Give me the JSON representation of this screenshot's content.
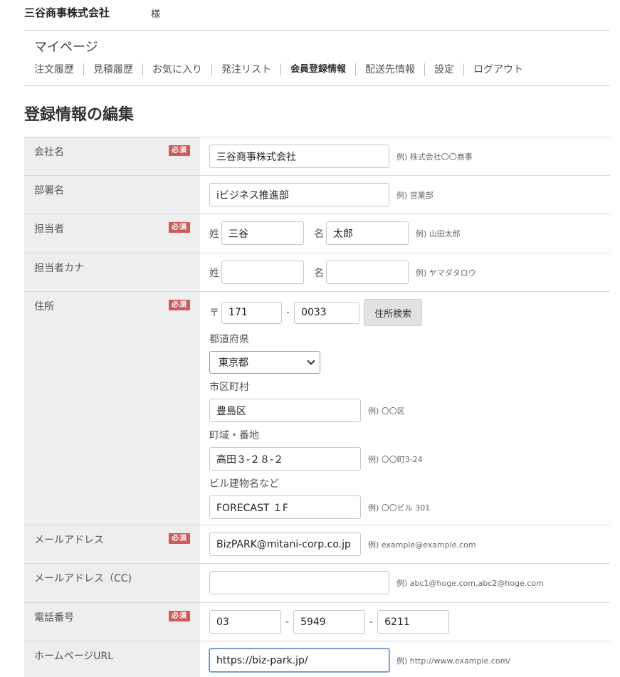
{
  "header": {
    "company": "三谷商事株式会社",
    "honorific": "様"
  },
  "mypage": {
    "title": "マイページ",
    "nav": [
      {
        "label": "注文履歴",
        "active": false
      },
      {
        "label": "見積履歴",
        "active": false
      },
      {
        "label": "お気に入り",
        "active": false
      },
      {
        "label": "発注リスト",
        "active": false
      },
      {
        "label": "会員登録情報",
        "active": true
      },
      {
        "label": "配送先情報",
        "active": false
      },
      {
        "label": "設定",
        "active": false
      },
      {
        "label": "ログアウト",
        "active": false
      }
    ]
  },
  "page_title": "登録情報の編集",
  "required_badge": "必須",
  "form": {
    "company": {
      "label": "会社名",
      "value": "三谷商事株式会社",
      "example": "例) 株式会社〇〇商事"
    },
    "department": {
      "label": "部署名",
      "value": "iビジネス推進部",
      "example": "例) 営業部"
    },
    "person": {
      "label": "担当者",
      "last_label": "姓",
      "last_value": "三谷",
      "first_label": "名",
      "first_value": "太郎",
      "example": "例) 山田太郎"
    },
    "person_kana": {
      "label": "担当者カナ",
      "last_label": "姓",
      "last_value": "",
      "first_label": "名",
      "first_value": "",
      "example": "例) ヤマダタロウ"
    },
    "address": {
      "label": "住所",
      "zip_mark": "〒",
      "zip1": "171",
      "zip2": "0033",
      "search_button": "住所検索",
      "prefecture_label": "都道府県",
      "prefecture_value": "東京都",
      "city_label": "市区町村",
      "city_value": "豊島区",
      "city_example": "例) 〇〇区",
      "town_label": "町域・番地",
      "town_value": "高田３-２８-２",
      "town_example": "例) 〇〇町3-24",
      "building_label": "ビル建物名など",
      "building_value": "FORECAST １F",
      "building_example": "例) 〇〇ビル 301"
    },
    "email": {
      "label": "メールアドレス",
      "value": "BizPARK@mitani-corp.co.jp",
      "example": "例) example@example.com"
    },
    "email_cc": {
      "label": "メールアドレス（CC)",
      "value": "",
      "example": "例) abc1@hoge.com,abc2@hoge.com"
    },
    "phone": {
      "label": "電話番号",
      "part1": "03",
      "part2": "5949",
      "part3": "6211"
    },
    "homepage": {
      "label": "ホームページURL",
      "value": "https://biz-park.jp/",
      "example": "例) http://www.example.com/"
    }
  }
}
